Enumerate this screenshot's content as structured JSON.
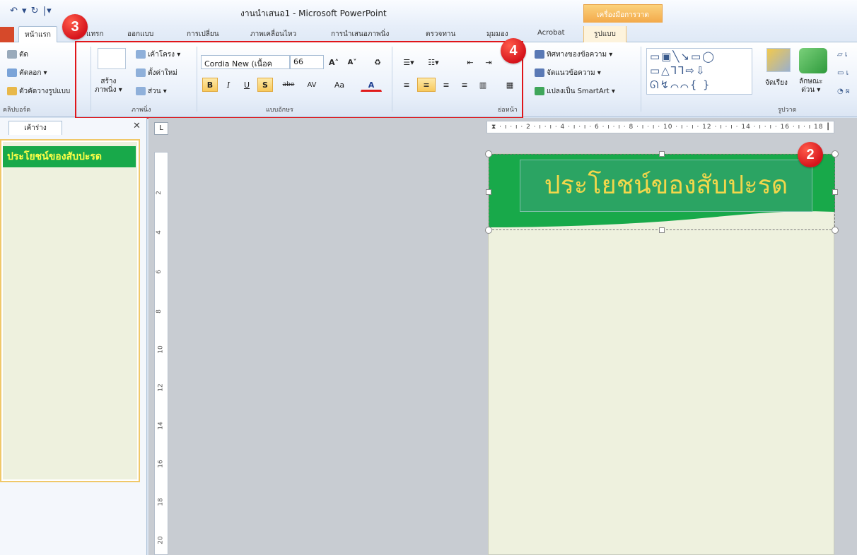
{
  "titlebar": {
    "quick_access": "↶ ▾ ↻ |▾",
    "title": "งานนำเสนอ1 - Microsoft PowerPoint",
    "context_tool": "เครื่องมือการวาด"
  },
  "tabs": {
    "home": "หน้าแรก",
    "insert": "แทรก",
    "design": "ออกแบบ",
    "transitions": "การเปลี่ยน",
    "animations": "ภาพเคลื่อนไหว",
    "slideshow": "การนำเสนอภาพนิ่ง",
    "review": "ตรวจทาน",
    "view": "มุมมอง",
    "acrobat": "Acrobat",
    "format": "รูปแบบ"
  },
  "clipboard": {
    "cut": "ตัด",
    "copy": "คัดลอก ▾",
    "format_painter": "ตัวคัดวางรูปแบบ",
    "label": "คลิปบอร์ด"
  },
  "slides_group": {
    "new_slide": "สร้าง\nภาพนิ่ง ▾",
    "layout": "เค้าโครง ▾",
    "reset": "ตั้งค่าใหม่",
    "section": "ส่วน ▾",
    "label": "ภาพนิ่ง"
  },
  "font_group": {
    "font_name": "Cordia New (เนื้อค",
    "font_size": "66",
    "grow": "A˄",
    "shrink": "A˅",
    "bold": "B",
    "italic": "I",
    "underline": "U",
    "shadow": "S",
    "strike": "abe",
    "spacing": "AV",
    "case": "Aa",
    "color": "A",
    "label": "แบบอักษร"
  },
  "paragraph_group": {
    "label": "ย่อหน้า"
  },
  "drawing": {
    "text_direction": "ทิศทางของข้อความ ▾",
    "align_text": "จัดแนวข้อความ ▾",
    "smartart": "แปลงเป็น SmartArt ▾",
    "shapes": "▭▣╲↘▭◯\n▭△⅂⅂⇨⇩\nᘏ↯⌒⌒{ }",
    "arrange": "จัดเรียง",
    "quick_styles": "ลักษณะ\nด่วน ▾",
    "label": "รูปวาด"
  },
  "callouts": {
    "two": "2",
    "three": "3",
    "four": "4"
  },
  "left_panel": {
    "tab_outline": "เค้าร่าง",
    "close": "✕",
    "thumb_title": "ประโยชน์ของสับปะรด"
  },
  "slide": {
    "title": "ประโยชน์ของสับปะรด"
  },
  "ruler": {
    "h": "⧗ · ı · ı · 2 · ı · ı · 4 · ı · ı · 6 · ı · ı · 8 · ı · ı · 10 · ı · ı · 12 · ı · ı · 14 · ı · ı · 16 · ı · ı 18 ┃",
    "v_marks": [
      "2",
      "4",
      "6",
      "8",
      "10",
      "12",
      "14",
      "16",
      "18",
      "20"
    ]
  },
  "colors": {
    "slide_green": "#18a94a",
    "title_text": "#f2d74b",
    "callout_red": "#e0161a"
  }
}
